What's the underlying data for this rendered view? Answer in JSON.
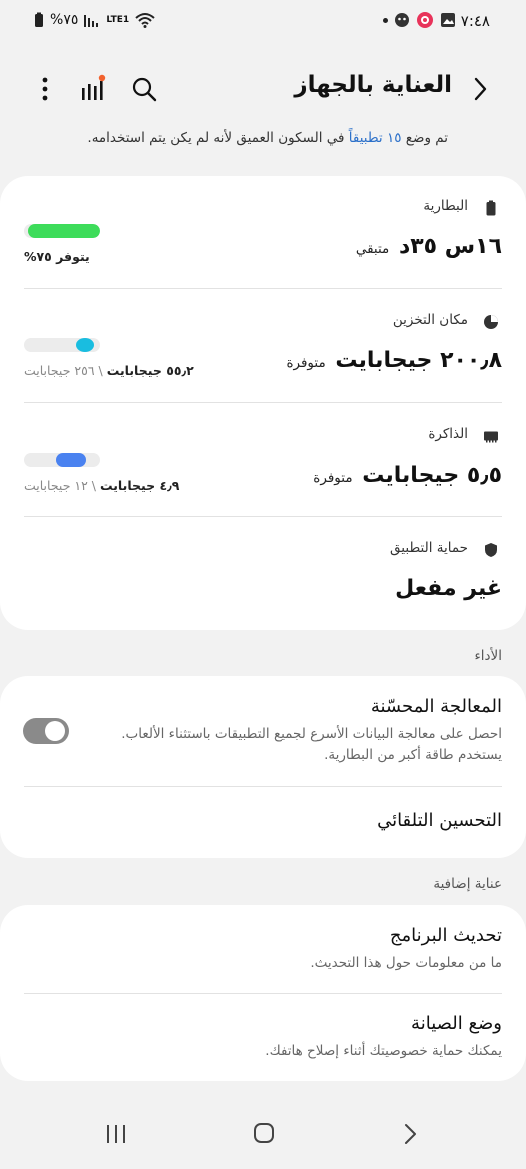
{
  "status_bar": {
    "time": "٧:٤٨",
    "battery": "%٧٥",
    "network": "LTE1"
  },
  "header": {
    "title": "العناية بالجهاز"
  },
  "notice": {
    "prefix": "تم وضع ",
    "link": "١٥ تطبيقاً",
    "suffix": " في السكون العميق لأنه لم يكن يتم استخدامه."
  },
  "battery": {
    "label": "البطارية",
    "value": "١٦س ٣٥د",
    "unit": "متبقي",
    "note": "يتوفر ٧٥%",
    "level": 0.75,
    "color": "#3ddc5a"
  },
  "storage": {
    "label": "مكان التخزين",
    "value": "٢٠٠٫٨ جيجابايت",
    "unit": "متوفرة",
    "used": "٥٥٫٢ جيجابايت",
    "total": "٢٥٦ جيجابايت",
    "level": 0.22,
    "color": "#19bde0"
  },
  "memory": {
    "label": "الذاكرة",
    "value": "٥٫٥ جيجابايت",
    "unit": "متوفرة",
    "used": "٤٫٩ جيجابايت",
    "total": "١٢ جيجابايت",
    "level": 0.41,
    "color": "#4a82f0"
  },
  "app_protection": {
    "label": "حماية التطبيق",
    "value": "غير مفعل"
  },
  "performance": {
    "section_label": "الأداء",
    "enhanced_title": "المعالجة المحسّنة",
    "enhanced_desc_1": "احصل على معالجة البيانات الأسرع لجميع التطبيقات باستثناء الألعاب.",
    "enhanced_desc_2": "يستخدم طاقة أكبر من البطارية.",
    "enhanced_on": false,
    "auto_opt_title": "التحسين التلقائي"
  },
  "additional": {
    "section_label": "عناية إضافية",
    "update_title": "تحديث البرنامج",
    "update_desc": "ما من معلومات حول هذا التحديث.",
    "maintenance_title": "وضع الصيانة",
    "maintenance_desc": "يمكنك حماية خصوصيتك أثناء إصلاح هاتفك."
  }
}
